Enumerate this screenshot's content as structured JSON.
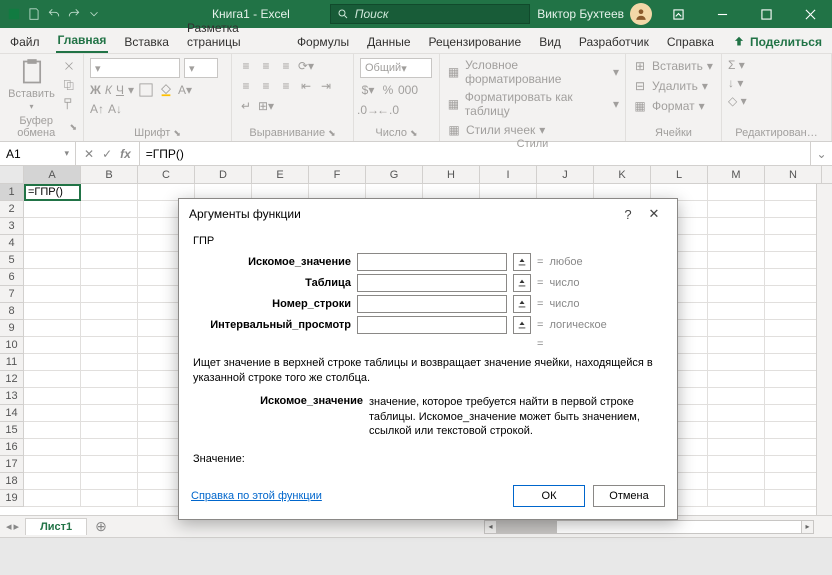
{
  "titlebar": {
    "doc_title": "Книга1 - Excel",
    "search_placeholder": "Поиск",
    "user_name": "Виктор Бухтеев"
  },
  "tabs": {
    "file": "Файл",
    "home": "Главная",
    "insert": "Вставка",
    "layout": "Разметка страницы",
    "formulas": "Формулы",
    "data": "Данные",
    "review": "Рецензирование",
    "view": "Вид",
    "developer": "Разработчик",
    "help": "Справка",
    "share": "Поделиться"
  },
  "ribbon": {
    "clipboard": {
      "paste": "Вставить",
      "group": "Буфер обмена"
    },
    "font": {
      "group": "Шрифт",
      "bold": "Ж",
      "italic": "К",
      "underline": "Ч"
    },
    "align": {
      "group": "Выравнивание"
    },
    "number": {
      "group": "Число",
      "format": "Общий"
    },
    "styles": {
      "group": "Стили",
      "cond": "Условное форматирование",
      "table": "Форматировать как таблицу",
      "cell": "Стили ячеек"
    },
    "cells": {
      "group": "Ячейки",
      "insert": "Вставить",
      "delete": "Удалить",
      "format": "Формат"
    },
    "editing": {
      "group": "Редактирован…"
    }
  },
  "namebox": "A1",
  "formula": "=ГПР()",
  "cell_a1": "=ГПР()",
  "columns": [
    "A",
    "B",
    "C",
    "D",
    "E",
    "F",
    "G",
    "H",
    "I",
    "J",
    "K",
    "L",
    "M",
    "N"
  ],
  "sheet_tab": "Лист1",
  "dialog": {
    "title": "Аргументы функции",
    "func": "ГПР",
    "args": {
      "a1": "Искомое_значение",
      "h1": "любое",
      "a2": "Таблица",
      "h2": "число",
      "a3": "Номер_строки",
      "h3": "число",
      "a4": "Интервальный_просмотр",
      "h4": "логическое"
    },
    "eq": "=",
    "desc": "Ищет значение в верхней строке таблицы и возвращает значение ячейки, находящейся в указанной строке того же столбца.",
    "arg_label": "Искомое_значение",
    "arg_desc": "значение, которое требуется найти в первой строке таблицы. Искомое_значение может быть значением, ссылкой или текстовой строкой.",
    "result": "Значение:",
    "help": "Справка по этой функции",
    "ok": "ОК",
    "cancel": "Отмена"
  }
}
